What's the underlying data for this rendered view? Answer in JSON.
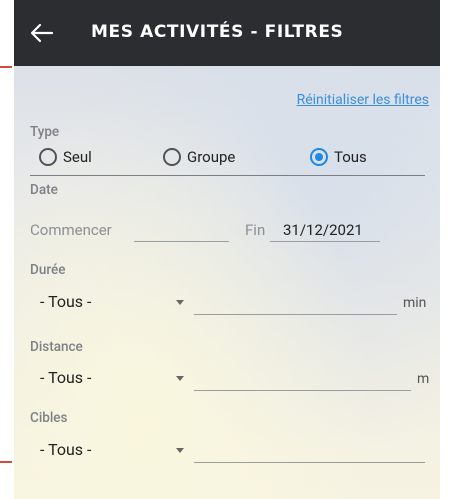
{
  "header": {
    "title": "MES ACTIVITÉS - FILTRES",
    "back_icon": "arrow-left-icon"
  },
  "reset_label": "Réinitialiser les filtres",
  "type": {
    "label": "Type",
    "options": [
      {
        "label": "Seul",
        "selected": false
      },
      {
        "label": "Groupe",
        "selected": false
      },
      {
        "label": "Tous",
        "selected": true
      }
    ]
  },
  "date": {
    "label": "Date",
    "start_label": "Commencer",
    "start_value": "",
    "end_label": "Fin",
    "end_value": "31/12/2021"
  },
  "duree": {
    "label": "Durée",
    "select": "- Tous -",
    "value": "",
    "unit": "min"
  },
  "distance": {
    "label": "Distance",
    "select": "- Tous -",
    "value": "",
    "unit": "m"
  },
  "cibles": {
    "label": "Cibles",
    "select": "- Tous -",
    "value": ""
  },
  "colors": {
    "appbar": "#2b2d31",
    "accent": "#1e88e5",
    "link": "#3b8ed8"
  }
}
